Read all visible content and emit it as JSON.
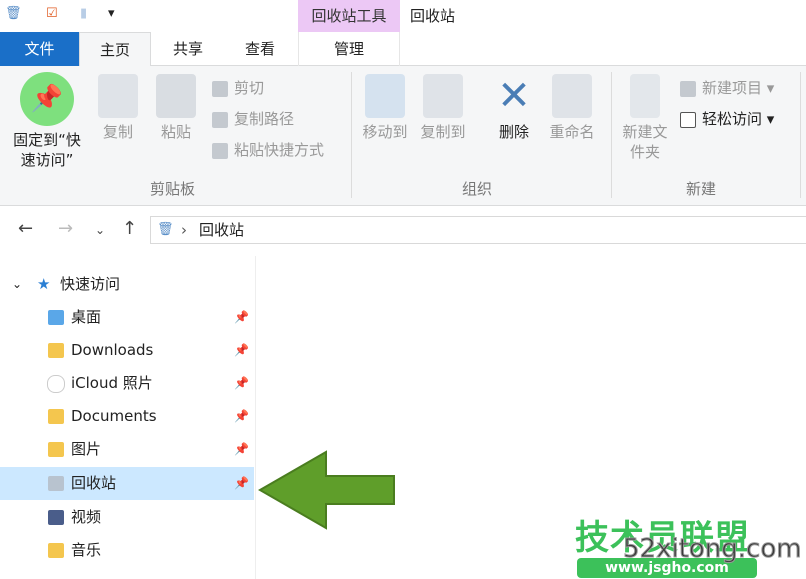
{
  "titlebar": {
    "title": "回收站",
    "context_tab": "回收站工具"
  },
  "tabs": [
    {
      "label": "文件"
    },
    {
      "label": "主页"
    },
    {
      "label": "共享"
    },
    {
      "label": "查看"
    },
    {
      "label": "管理"
    }
  ],
  "ribbon": {
    "pin_quick": "固定到“快速访问”",
    "copy": "复制",
    "paste": "粘贴",
    "cut": "剪切",
    "copy_path": "复制路径",
    "paste_shortcut": "粘贴快捷方式",
    "group_clipboard": "剪贴板",
    "move_to": "移动到",
    "copy_to": "复制到",
    "delete": "删除",
    "rename": "重命名",
    "group_organize": "组织",
    "new_folder": "新建文件夹",
    "new_item": "新建项目",
    "easy_access": "轻松访问",
    "group_new": "新建"
  },
  "address": {
    "path": "回收站"
  },
  "nav": {
    "quick_access": "快速访问",
    "items": [
      {
        "label": "桌面"
      },
      {
        "label": "Downloads"
      },
      {
        "label": "iCloud 照片"
      },
      {
        "label": "Documents"
      },
      {
        "label": "图片"
      },
      {
        "label": "回收站",
        "selected": true
      },
      {
        "label": "视频"
      },
      {
        "label": "音乐"
      }
    ]
  },
  "watermark": {
    "line1": "技术员联盟",
    "line2": "www.jsgho.com",
    "line3": "52xitong.com"
  },
  "colors": {
    "accent": "#1a6fc8",
    "selected": "#cce8ff",
    "context": "#ecc8f5",
    "arrow": "#5f9e2a"
  }
}
